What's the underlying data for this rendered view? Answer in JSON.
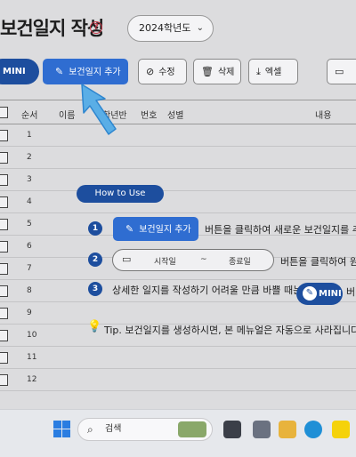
{
  "header": {
    "title": "보건일지 작성",
    "help_glyph": "?",
    "year_select": "2024학년도"
  },
  "toolbar": {
    "mini": "MINI",
    "add": "보건일지 추가",
    "edit": "수정",
    "delete": "삭제",
    "excel": "엑셀"
  },
  "table": {
    "headers": {
      "order": "순서",
      "name": "이름",
      "class": "학년반",
      "number": "번호",
      "gender": "성별",
      "content": "내용"
    },
    "rows": [
      "1",
      "2",
      "3",
      "4",
      "5",
      "6",
      "7",
      "8",
      "9",
      "10",
      "11",
      "12"
    ]
  },
  "guide": {
    "title": "How to Use",
    "step1_num": "1",
    "step1_button": "보건일지 추가",
    "step1_text": "버튼을 클릭하여 새로운 보건일지를 추",
    "step2_num": "2",
    "step2_start": "시작일",
    "step2_sep": "~",
    "step2_end": "종료일",
    "step2_text": "버튼을 클릭하여 원",
    "step3_num": "3",
    "step3_text": "상세한 일지를 작성하기 어려울 만큼 바쁠 때는",
    "step3_button": "MINI",
    "step3_tail": "버",
    "tip": "Tip. 보건일지를 생성하시면, 본 메뉴얼은 자동으로 사라집니다."
  },
  "taskbar": {
    "search_placeholder": "검색"
  },
  "colors": {
    "primary": "#2f6dd1",
    "navy": "#1d4e9e",
    "arrow": "#5aaee6"
  },
  "icons": [
    "help-icon",
    "chevron-down-icon",
    "edit-icon",
    "link-icon",
    "trash-icon",
    "download-icon",
    "calendar-icon",
    "lightbulb-icon",
    "windows-icon",
    "search-icon"
  ]
}
